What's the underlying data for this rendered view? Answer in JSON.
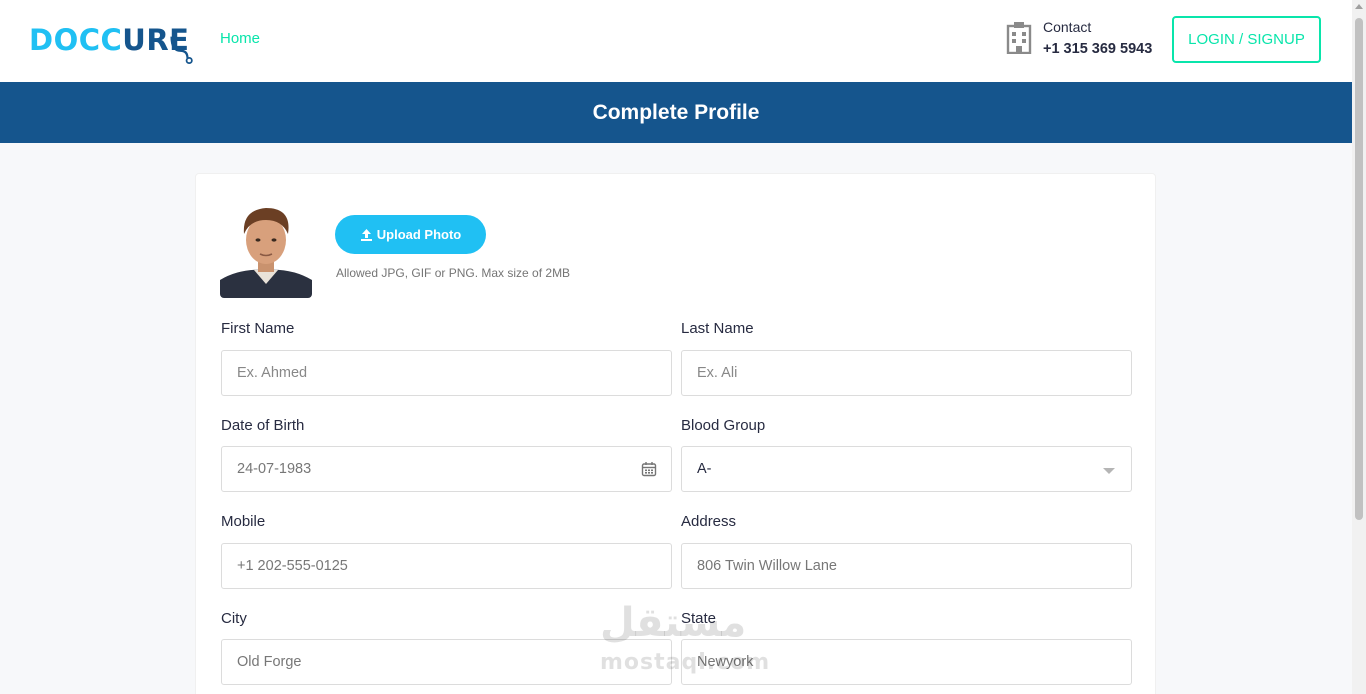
{
  "header": {
    "logo_part1": "DOCC",
    "logo_part2": "URE",
    "nav_home": "Home",
    "contact_label": "Contact",
    "contact_phone": "+1 315 369 5943",
    "login_label": "LOGIN / SIGNUP"
  },
  "banner": {
    "title": "Complete Profile"
  },
  "profile": {
    "upload_label": "Upload Photo",
    "upload_hint": "Allowed JPG, GIF or PNG. Max size of 2MB"
  },
  "form": {
    "first_name": {
      "label": "First Name",
      "placeholder": "Ex. Ahmed"
    },
    "last_name": {
      "label": "Last Name",
      "placeholder": "Ex. Ali"
    },
    "dob": {
      "label": "Date of Birth",
      "value": "24-07-1983"
    },
    "blood_group": {
      "label": "Blood Group",
      "value": "A-"
    },
    "mobile": {
      "label": "Mobile",
      "value": "+1 202-555-0125"
    },
    "address": {
      "label": "Address",
      "value": "806 Twin Willow Lane"
    },
    "city": {
      "label": "City",
      "value": "Old Forge"
    },
    "state": {
      "label": "State",
      "value": "Newyork"
    }
  },
  "watermark": {
    "arabic": "مستقل",
    "latin": "mostaql.com"
  },
  "colors": {
    "primary_blue": "#15558d",
    "accent_cyan": "#20c0f3",
    "accent_green": "#09e5ab"
  }
}
